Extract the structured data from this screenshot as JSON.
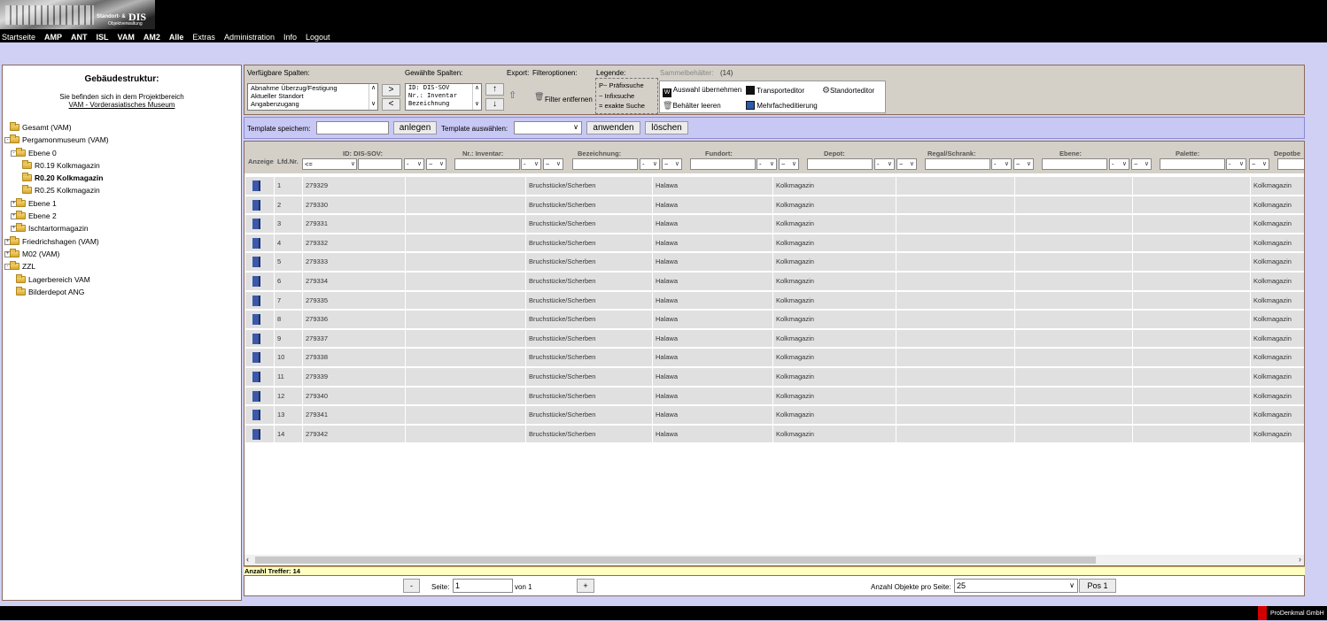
{
  "logo": {
    "small1": "Standort- &",
    "main": "DIS",
    "small2": "Objektverwaltung"
  },
  "nav": [
    "Startseite",
    "AMP",
    "ANT",
    "ISL",
    "VAM",
    "AM2",
    "Alle",
    "Extras",
    "Administration",
    "Info",
    "Logout"
  ],
  "left": {
    "title": "Gebäudestruktur:",
    "project_text": "Sie befinden sich in dem Projektbereich",
    "project_link": "VAM - Vorderasiatisches Museum",
    "tree": [
      {
        "label": "Gesamt (VAM)",
        "toggle": ""
      },
      {
        "label": "Pergamonmuseum (VAM)",
        "toggle": "-"
      },
      {
        "label": "Ebene 0",
        "toggle": "-"
      },
      {
        "label": "R0.19 Kolkmagazin",
        "toggle": ""
      },
      {
        "label": "R0.20 Kolkmagazin",
        "toggle": ""
      },
      {
        "label": "R0.25 Kolkmagazin",
        "toggle": ""
      },
      {
        "label": "Ebene 1",
        "toggle": "+"
      },
      {
        "label": "Ebene 2",
        "toggle": "+"
      },
      {
        "label": "Ischtartormagazin",
        "toggle": "+"
      },
      {
        "label": "Friedrichshagen (VAM)",
        "toggle": "+"
      },
      {
        "label": "M02 (VAM)",
        "toggle": "+"
      },
      {
        "label": "ZZL",
        "toggle": "-"
      },
      {
        "label": "Lagerbereich VAM",
        "toggle": ""
      },
      {
        "label": "Bilderdepot ANG",
        "toggle": ""
      }
    ]
  },
  "toolbar": {
    "available_label": "Verfügbare Spalten:",
    "available_items": [
      "Abnahme Überzug/Festigung",
      "Aktueller Standort",
      "Angabenzugang"
    ],
    "selected_label": "Gewählte Spalten:",
    "selected_items": [
      "ID: DIS-SOV",
      "Nr.: Inventar",
      "Bezeichnung"
    ],
    "move_right": ">",
    "move_left": "<",
    "move_up": "↑",
    "move_down": "↓",
    "export_label": "Export:",
    "filteroptions_label": "Filteroptionen:",
    "filter_remove": "Filter entfernen",
    "legend_label": "Legende:",
    "legend_items": [
      "P~  Präfixsuche",
      "~    Infixsuche",
      "=    exakte Suche"
    ],
    "sammel_label": "Sammelbehälter:",
    "sammel_count": "(14)",
    "sammel_actions": [
      "Auswahl übernehmen",
      "Transporteditor",
      "Standorteditor",
      "Behälter leeren",
      "Mehrfacheditierung"
    ]
  },
  "template_bar": {
    "save_label": "Template speichern:",
    "create_button": "anlegen",
    "select_label": "Template auswählen:",
    "apply_button": "anwenden",
    "delete_button": "löschen"
  },
  "grid": {
    "headers": [
      "Anzeige",
      "Lfd.Nr.",
      "ID: DIS-SOV:",
      "Nr.: Inventar:",
      "Bezeichnung:",
      "Fundort:",
      "Depot:",
      "Regal/Schrank:",
      "Ebene:",
      "Palette:",
      "Depotbe"
    ],
    "id_operator": "<=",
    "filter_symbols": [
      "-",
      "~"
    ],
    "rows": [
      {
        "nr": "1",
        "id": "279329",
        "inventar": "",
        "bez": "Bruchstücke/Scherben",
        "fundort": "Halawa",
        "depot": "Kolkmagazin",
        "depotbe": "Kolkmagazin"
      },
      {
        "nr": "2",
        "id": "279330",
        "inventar": "",
        "bez": "Bruchstücke/Scherben",
        "fundort": "Halawa",
        "depot": "Kolkmagazin",
        "depotbe": "Kolkmagazin"
      },
      {
        "nr": "3",
        "id": "279331",
        "inventar": "",
        "bez": "Bruchstücke/Scherben",
        "fundort": "Halawa",
        "depot": "Kolkmagazin",
        "depotbe": "Kolkmagazin"
      },
      {
        "nr": "4",
        "id": "279332",
        "inventar": "",
        "bez": "Bruchstücke/Scherben",
        "fundort": "Halawa",
        "depot": "Kolkmagazin",
        "depotbe": "Kolkmagazin"
      },
      {
        "nr": "5",
        "id": "279333",
        "inventar": "",
        "bez": "Bruchstücke/Scherben",
        "fundort": "Halawa",
        "depot": "Kolkmagazin",
        "depotbe": "Kolkmagazin"
      },
      {
        "nr": "6",
        "id": "279334",
        "inventar": "",
        "bez": "Bruchstücke/Scherben",
        "fundort": "Halawa",
        "depot": "Kolkmagazin",
        "depotbe": "Kolkmagazin"
      },
      {
        "nr": "7",
        "id": "279335",
        "inventar": "",
        "bez": "Bruchstücke/Scherben",
        "fundort": "Halawa",
        "depot": "Kolkmagazin",
        "depotbe": "Kolkmagazin"
      },
      {
        "nr": "8",
        "id": "279336",
        "inventar": "",
        "bez": "Bruchstücke/Scherben",
        "fundort": "Halawa",
        "depot": "Kolkmagazin",
        "depotbe": "Kolkmagazin"
      },
      {
        "nr": "9",
        "id": "279337",
        "inventar": "",
        "bez": "Bruchstücke/Scherben",
        "fundort": "Halawa",
        "depot": "Kolkmagazin",
        "depotbe": "Kolkmagazin"
      },
      {
        "nr": "10",
        "id": "279338",
        "inventar": "",
        "bez": "Bruchstücke/Scherben",
        "fundort": "Halawa",
        "depot": "Kolkmagazin",
        "depotbe": "Kolkmagazin"
      },
      {
        "nr": "11",
        "id": "279339",
        "inventar": "",
        "bez": "Bruchstücke/Scherben",
        "fundort": "Halawa",
        "depot": "Kolkmagazin",
        "depotbe": "Kolkmagazin"
      },
      {
        "nr": "12",
        "id": "279340",
        "inventar": "",
        "bez": "Bruchstücke/Scherben",
        "fundort": "Halawa",
        "depot": "Kolkmagazin",
        "depotbe": "Kolkmagazin"
      },
      {
        "nr": "13",
        "id": "279341",
        "inventar": "",
        "bez": "Bruchstücke/Scherben",
        "fundort": "Halawa",
        "depot": "Kolkmagazin",
        "depotbe": "Kolkmagazin"
      },
      {
        "nr": "14",
        "id": "279342",
        "inventar": "",
        "bez": "Bruchstücke/Scherben",
        "fundort": "Halawa",
        "depot": "Kolkmagazin",
        "depotbe": "Kolkmagazin"
      }
    ]
  },
  "status": {
    "treffer_label": "Anzahl Treffer:",
    "treffer_count": "14"
  },
  "pager": {
    "prev": "-",
    "page_label": "Seite:",
    "page_value": "1",
    "of_label": "von 1",
    "next": "+",
    "per_page_label": "Anzahl Objekte pro Seite:",
    "per_page_value": "25",
    "pos_button": "Pos 1"
  },
  "footer": {
    "company": "ProDenkmal GmbH"
  },
  "colors": {
    "accent": "#d0d0f4",
    "template_bar": "#c8c8f4",
    "row_bg": "#e0e0e0",
    "book_icon": "#3c58a8",
    "footer_red": "#d00000"
  }
}
